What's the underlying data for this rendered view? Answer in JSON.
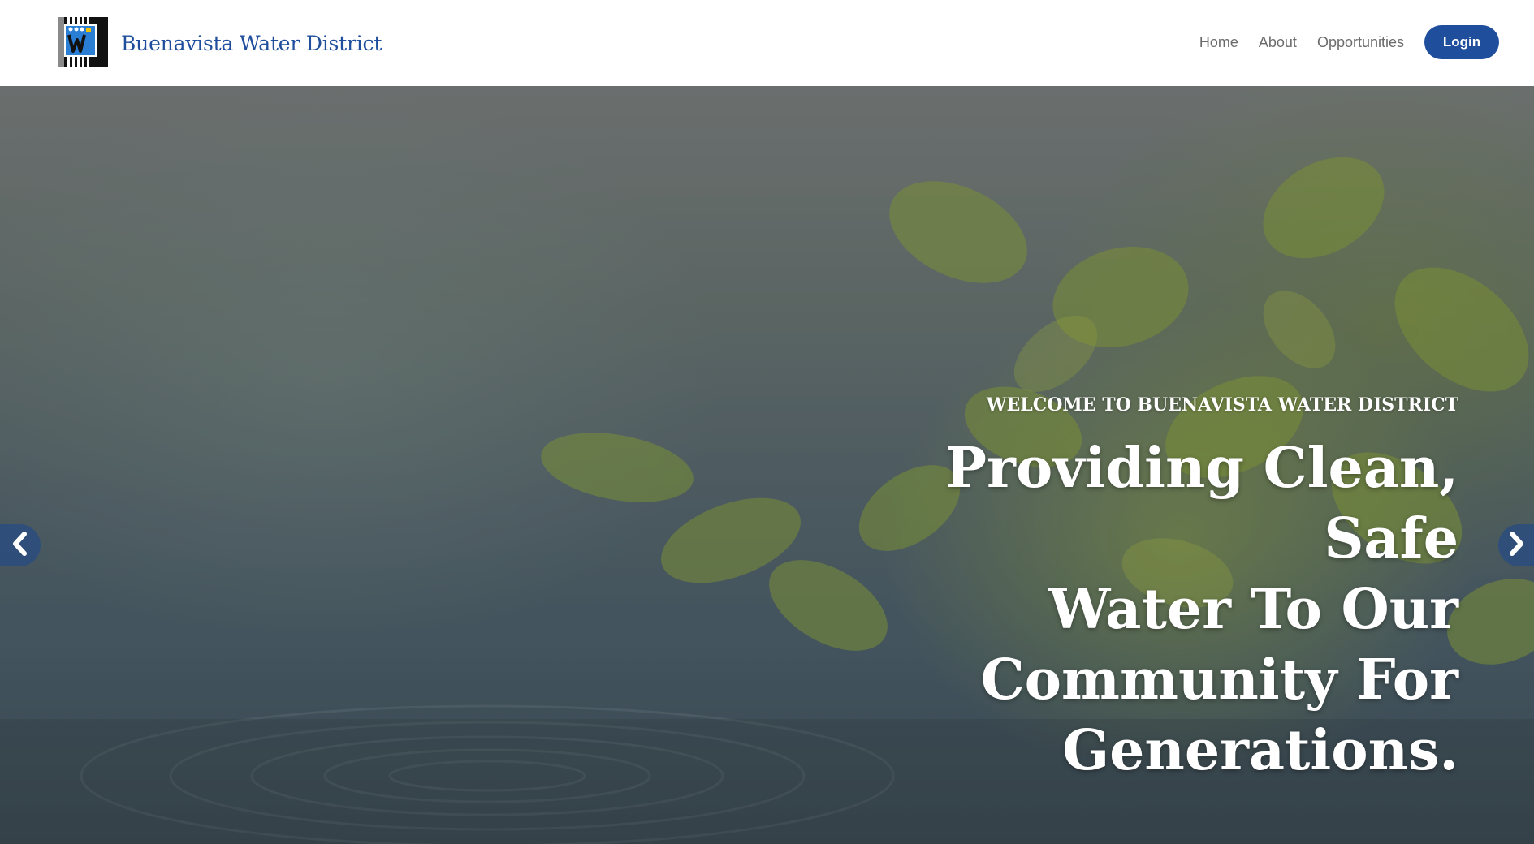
{
  "header": {
    "brand_name": "Buenavista Water District",
    "logo_icon": "water-district-logo-icon",
    "nav": [
      {
        "label": "Home"
      },
      {
        "label": "About"
      },
      {
        "label": "Opportunities"
      }
    ],
    "login_label": "Login"
  },
  "hero": {
    "eyebrow": "WELCOME TO BUENAVISTA WATER DISTRICT",
    "headline_lines": [
      "Providing Clean, Safe",
      "Water To Our",
      "Community For",
      "Generations."
    ],
    "prev_icon": "chevron-left-icon",
    "next_icon": "chevron-right-icon"
  },
  "colors": {
    "brand": "#1f4e9c",
    "nav_text": "#6b6b6b",
    "hero_text": "#ffffff"
  }
}
